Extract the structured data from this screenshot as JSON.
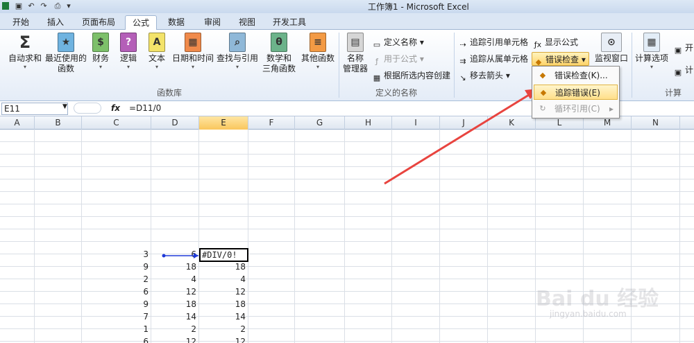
{
  "window": {
    "title": "工作簿1 - Microsoft Excel"
  },
  "tabs": [
    "开始",
    "插入",
    "页面布局",
    "公式",
    "数据",
    "审阅",
    "视图",
    "开发工具"
  ],
  "active_tab": "公式",
  "ribbon": {
    "function_library": {
      "group_label": "函数库",
      "buttons": [
        {
          "label": "自动求和",
          "icon": "sigma-icon"
        },
        {
          "label": "最近使用的\n函数",
          "icon": "book-star-icon"
        },
        {
          "label": "财务",
          "icon": "book-finance-icon"
        },
        {
          "label": "逻辑",
          "icon": "book-question-icon"
        },
        {
          "label": "文本",
          "icon": "book-text-icon"
        },
        {
          "label": "日期和时间",
          "icon": "book-calendar-icon"
        },
        {
          "label": "查找与引用",
          "icon": "book-search-icon"
        },
        {
          "label": "数学和\n三角函数",
          "icon": "book-theta-icon"
        },
        {
          "label": "其他函数",
          "icon": "book-more-icon"
        }
      ]
    },
    "defined_names": {
      "group_label": "定义的名称",
      "name_manager": "名称\n管理器",
      "define_name": "定义名称",
      "use_in_formula": "用于公式",
      "create_from_selection": "根据所选内容创建"
    },
    "formula_auditing": {
      "trace_precedents": "追踪引用单元格",
      "trace_dependents": "追踪从属单元格",
      "remove_arrows": "移去箭头",
      "show_formulas": "显示公式",
      "error_checking": "错误检查",
      "watch_window": "监视窗口"
    },
    "calculation": {
      "group_label": "计算",
      "calc_options": "计算选项",
      "calc_now_partial": "开",
      "calc_sheet_partial": "计"
    }
  },
  "dropdown": {
    "items": [
      {
        "label": "错误检查(K)...",
        "icon": "error-check-icon",
        "state": "normal"
      },
      {
        "label": "追踪错误(E)",
        "icon": "trace-error-icon",
        "state": "hover"
      },
      {
        "label": "循环引用(C)",
        "icon": "circular-ref-icon",
        "state": "disabled"
      }
    ]
  },
  "formula_bar": {
    "name_box": "E11",
    "fx": "fx",
    "formula": "=D11/0"
  },
  "columns": [
    "A",
    "B",
    "C",
    "D",
    "E",
    "F",
    "G",
    "H",
    "I",
    "J",
    "K",
    "L",
    "M",
    "N"
  ],
  "selected_column": "E",
  "table": {
    "rows": [
      {
        "c": "3",
        "d": "6",
        "e": "#DIV/0!"
      },
      {
        "c": "9",
        "d": "18",
        "e": "18"
      },
      {
        "c": "2",
        "d": "4",
        "e": "4"
      },
      {
        "c": "6",
        "d": "12",
        "e": "12"
      },
      {
        "c": "9",
        "d": "18",
        "e": "18"
      },
      {
        "c": "7",
        "d": "14",
        "e": "14"
      },
      {
        "c": "1",
        "d": "2",
        "e": "2"
      },
      {
        "c": "6",
        "d": "12",
        "e": "12"
      }
    ]
  },
  "watermark": {
    "brand": "Bai du 经验",
    "url": "jingyan.baidu.com"
  },
  "colors": {
    "arrow": "#e8443f",
    "trace_arrow": "#1f3ad8",
    "accent": "#f9c65c"
  }
}
